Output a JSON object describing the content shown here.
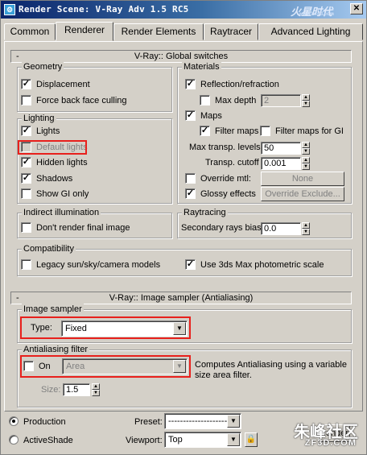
{
  "window": {
    "title": "Render Scene: V-Ray Adv 1.5 RC5",
    "watermark_top": "火星时代",
    "watermark_top_url": "www.hxsd.com",
    "watermark_bottom": "朱峰社区",
    "watermark_bottom_url": "ZF3D.COM"
  },
  "tabs": [
    "Common",
    "Renderer",
    "Render Elements",
    "Raytracer",
    "Advanced Lighting"
  ],
  "global_switches": {
    "header": "V-Ray:: Global switches",
    "geometry": {
      "label": "Geometry",
      "displacement": "Displacement",
      "force_back_face": "Force back face culling"
    },
    "materials": {
      "label": "Materials",
      "reflection_refraction": "Reflection/refraction",
      "max_depth": "Max depth",
      "max_depth_value": "2",
      "maps": "Maps",
      "filter_maps": "Filter maps",
      "filter_maps_gi": "Filter maps for GI",
      "max_transp_levels": "Max transp. levels",
      "max_transp_levels_value": "50",
      "transp_cutoff": "Transp. cutoff",
      "transp_cutoff_value": "0.001",
      "override_mtl": "Override mtl:",
      "override_mtl_button": "None",
      "glossy_effects": "Glossy effects",
      "override_exclude": "Override Exclude..."
    },
    "lighting": {
      "label": "Lighting",
      "lights": "Lights",
      "default_lights": "Default lights",
      "hidden_lights": "Hidden lights",
      "shadows": "Shadows",
      "show_gi_only": "Show GI only"
    },
    "indirect": {
      "label": "Indirect illumination",
      "dont_render": "Don't render final image"
    },
    "raytracing": {
      "label": "Raytracing",
      "secondary_bias": "Secondary rays bias",
      "secondary_bias_value": "0.0"
    },
    "compatibility": {
      "label": "Compatibility",
      "legacy": "Legacy sun/sky/camera models",
      "use_3ds": "Use 3ds Max photometric scale"
    }
  },
  "image_sampler": {
    "header": "V-Ray:: Image sampler (Antialiasing)",
    "group_label": "Image sampler",
    "type_label": "Type:",
    "type_value": "Fixed",
    "aa_label": "Antialiasing filter",
    "on_label": "On",
    "filter_value": "Area",
    "filter_desc": "Computes Antialiasing using a variable size area filter.",
    "size_label": "Size:",
    "size_value": "1.5"
  },
  "bottom": {
    "production": "Production",
    "activeshade": "ActiveShade",
    "preset_label": "Preset:",
    "preset_value": "-------------------------",
    "viewport_label": "Viewport:",
    "viewport_value": "Top",
    "render_button": "Render"
  },
  "highlight_color": "#e8201c"
}
